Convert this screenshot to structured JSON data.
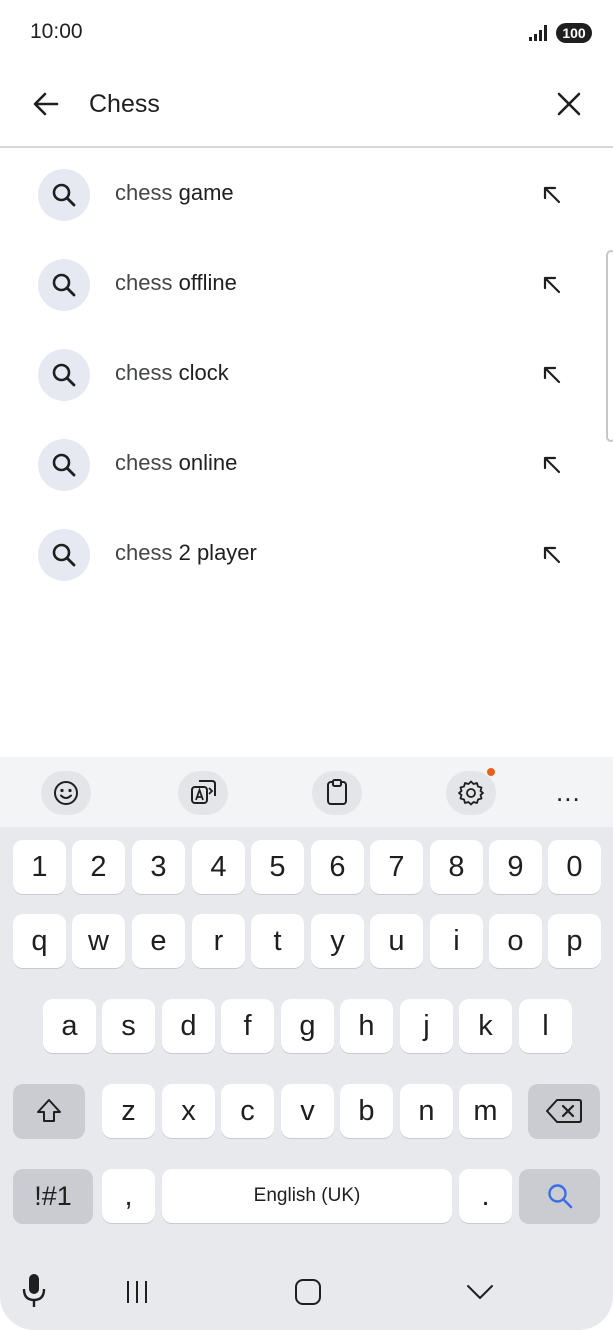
{
  "status_bar": {
    "time": "10:00",
    "battery": "100"
  },
  "search": {
    "query": "Chess"
  },
  "suggestions": [
    {
      "prefix": "chess ",
      "completion": "game"
    },
    {
      "prefix": "chess ",
      "completion": "offline"
    },
    {
      "prefix": "chess ",
      "completion": "clock"
    },
    {
      "prefix": "chess ",
      "completion": "online"
    },
    {
      "prefix": "chess ",
      "completion": "2 player"
    }
  ],
  "keyboard": {
    "toolbar": [
      "emoji-icon",
      "translate-icon",
      "clipboard-icon",
      "settings-icon",
      "more-icon"
    ],
    "toolbar_more": "...",
    "number_row": [
      "1",
      "2",
      "3",
      "4",
      "5",
      "6",
      "7",
      "8",
      "9",
      "0"
    ],
    "row1": [
      "q",
      "w",
      "e",
      "r",
      "t",
      "y",
      "u",
      "i",
      "o",
      "p"
    ],
    "row2": [
      "a",
      "s",
      "d",
      "f",
      "g",
      "h",
      "j",
      "k",
      "l"
    ],
    "row3": [
      "z",
      "x",
      "c",
      "v",
      "b",
      "n",
      "m"
    ],
    "symbols_label": "!#1",
    "comma": ",",
    "space_label": "English (UK)",
    "period": "."
  },
  "colors": {
    "accent_blue": "#3a6ee8",
    "notification_dot": "#e8601c",
    "suggestion_icon_bg": "#e6e9f2",
    "keyboard_bg": "#e8e9ed"
  }
}
